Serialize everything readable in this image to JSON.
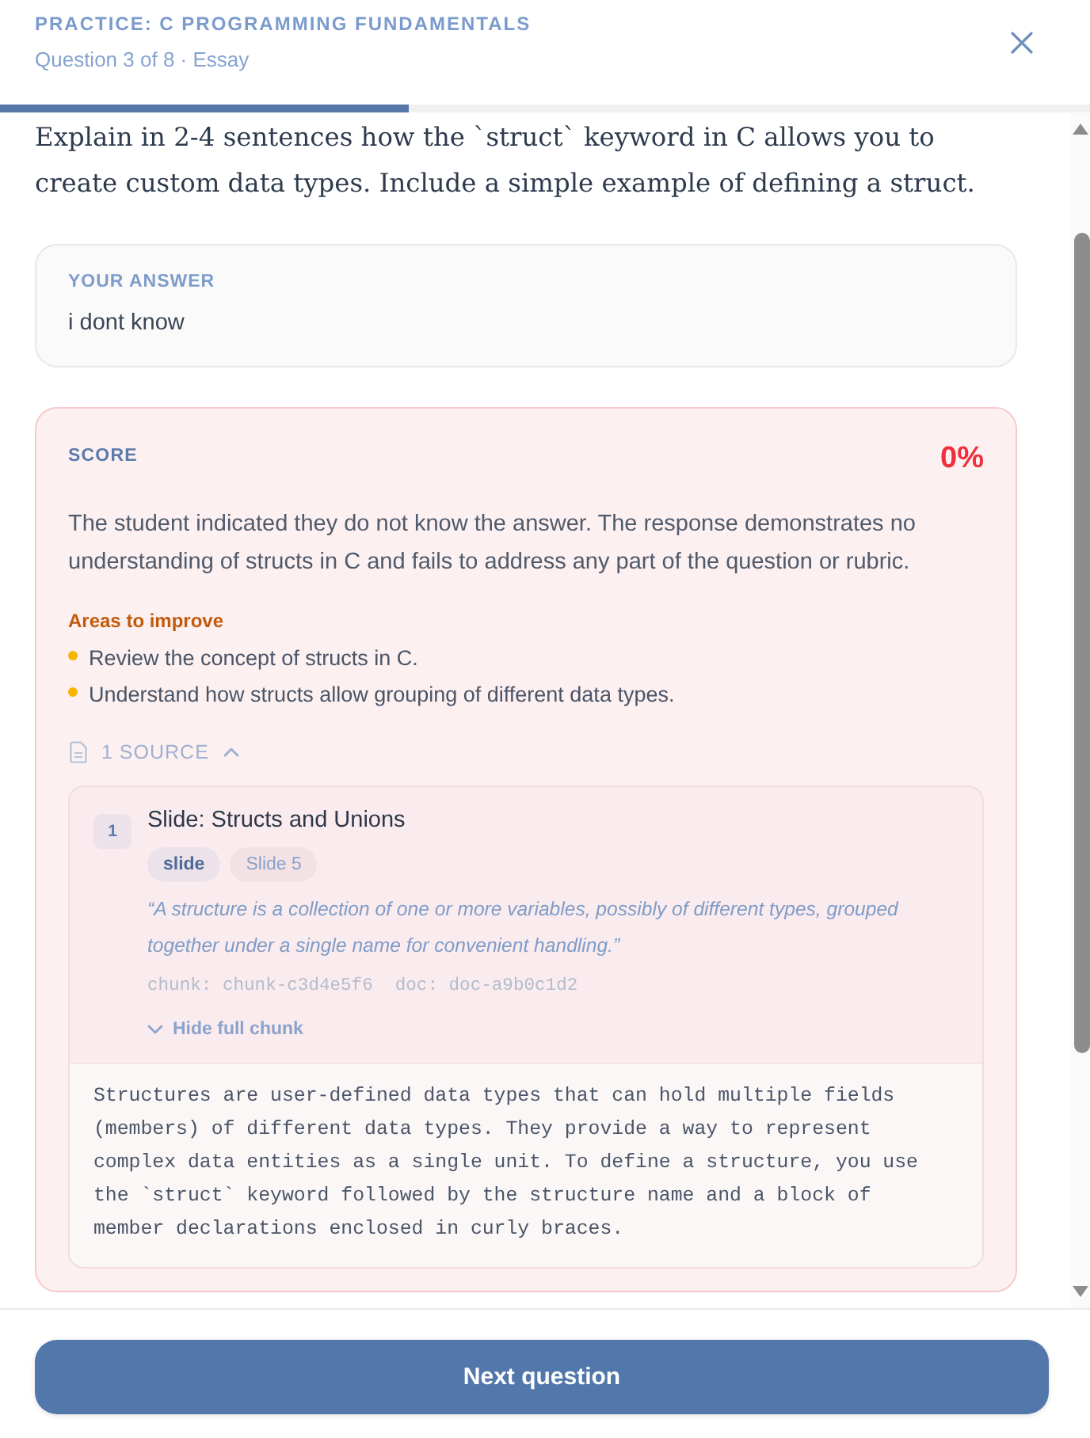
{
  "header": {
    "title": "PRACTICE: C PROGRAMMING FUNDAMENTALS",
    "subtitle": "Question 3 of 8 · Essay"
  },
  "progress": {
    "level": 0.375
  },
  "question": {
    "text": "Explain in 2-4 sentences how the `struct` keyword in C allows you to create custom data types. Include a simple example of defining a struct."
  },
  "answer": {
    "label": "YOUR ANSWER",
    "value": "i dont know"
  },
  "score": {
    "label": "SCORE",
    "value": "0%",
    "feedback": "The student indicated they do not know the answer. The response demonstrates no understanding of structs in C and fails to address any part of the question or rubric.",
    "improve_heading": "Areas to improve",
    "improvements": [
      "Review the concept of structs in C.",
      "Understand how structs allow grouping of different data types."
    ],
    "sources_toggle": {
      "label": "1 SOURCE",
      "expanded": true
    },
    "sources": [
      {
        "number": "1",
        "title": "Slide: Structs and Unions",
        "tags": [
          {
            "label": "slide",
            "kind": "type"
          },
          {
            "label": "Slide 5",
            "kind": "location"
          }
        ],
        "quote": "“A structure is a collection of one or more variables, possibly of different types, grouped together under a single name for convenient handling.”",
        "chunk_id": "chunk: chunk-c3d4e5f6",
        "doc_id": "doc: doc-a9b0c1d2",
        "chunk_toggle": {
          "label": "Hide full chunk",
          "expanded": true
        },
        "full_chunk": "Structures are user-defined data types that can hold multiple fields (members) of different data types. They provide a way to represent complex data entities as a single unit. To define a structure, you use the `struct` keyword followed by the structure name and a block of member declarations enclosed in curly braces."
      }
    ]
  },
  "footer": {
    "next_button": "Next question"
  }
}
